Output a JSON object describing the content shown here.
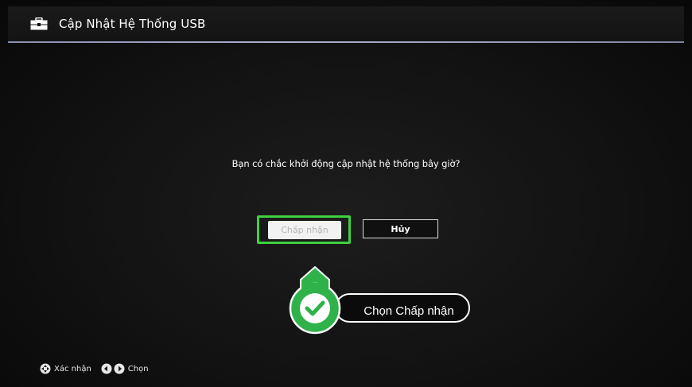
{
  "header": {
    "icon": "toolbox-icon",
    "title": "Cập Nhật Hệ Thống USB"
  },
  "dialog": {
    "question": "Bạn có chắc khởi động cập nhật hệ thống bây giờ?",
    "accept_label": "Chấp nhận",
    "cancel_label": "Hủy"
  },
  "callout": {
    "icon": "check-icon",
    "label": "Chọn Chấp nhận"
  },
  "footer": {
    "confirm_icon": "dpad-icon",
    "confirm_label": "Xác nhận",
    "select_icons": [
      "left-arrow-button-icon",
      "right-arrow-button-icon"
    ],
    "select_label": "Chọn"
  },
  "colors": {
    "focus_green": "#3fd13f",
    "callout_green": "#2fb24a",
    "header_rule": "#aab0d0",
    "background": "#121212"
  }
}
